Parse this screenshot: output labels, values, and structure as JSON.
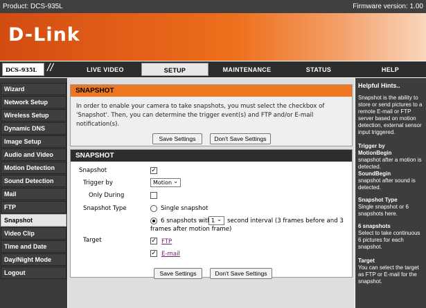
{
  "header": {
    "product": "Product: DCS-935L",
    "firmware": "Firmware version: 1.00",
    "brand": "D-Link",
    "model": "DCS-935L",
    "slashes": "//"
  },
  "nav": {
    "tabs": [
      "LIVE VIDEO",
      "SETUP",
      "MAINTENANCE",
      "STATUS",
      "HELP"
    ],
    "active": "SETUP"
  },
  "sidebar": {
    "items": [
      "Wizard",
      "Network Setup",
      "Wireless Setup",
      "Dynamic DNS",
      "Image Setup",
      "Audio and Video",
      "Motion Detection",
      "Sound Detection",
      "Mail",
      "FTP",
      "Snapshot",
      "Video Clip",
      "Time and Date",
      "Day/Night Mode",
      "Logout"
    ],
    "active": "Snapshot"
  },
  "intro": {
    "title": "SNAPSHOT",
    "description": "In order to enable your camera to take snapshots, you must select the checkbox of 'Snapshot'. Then, you can determine the trigger event(s) and FTP and/or E-mail notification(s).",
    "save_label": "Save Settings",
    "dont_save_label": "Don't Save Settings"
  },
  "settings": {
    "title": "SNAPSHOT",
    "snapshot_label": "Snapshot",
    "snapshot_checked": true,
    "trigger_label": "Trigger by",
    "trigger_value": "Motion",
    "only_during_label": "Only During",
    "only_during_checked": false,
    "type_label": "Snapshot Type",
    "single_label": "Single snapshot",
    "multi_prefix": "6 snapshots with",
    "interval_value": "1",
    "multi_suffix": "second interval (3 frames before and 3",
    "multi_suffix2": "frames after motion frame)",
    "target_label": "Target",
    "ftp_label": "FTP",
    "email_label": "E-mail",
    "ftp_checked": true,
    "email_checked": true,
    "check_mark": "✓"
  },
  "footer_buttons": {
    "save_label": "Save Settings",
    "dont_save_label": "Don't Save Settings"
  },
  "hints": {
    "title": "Helpful Hints..",
    "intro": "Snapshot is the ability to store or send pictures to a remote E-mail or FTP server based on motion detection, external sensor input triggered.",
    "trigger_title": "Trigger by",
    "trigger_sub1": "MotionBegin",
    "trigger_text1": "snapshot after a motion is detected.",
    "trigger_sub2": "SoundBegin",
    "trigger_text2": "snapshot after sound is detected.",
    "type_title": "Snapshot Type",
    "type_text": "Single snapshot or 6 snapshots here.",
    "six_title": "6 snapshots",
    "six_text": "Select to take continuous 6 pictures for each snapshot.",
    "target_title": "Target",
    "target_text": "You can select the target as FTP or E-mail for the snapshot."
  }
}
